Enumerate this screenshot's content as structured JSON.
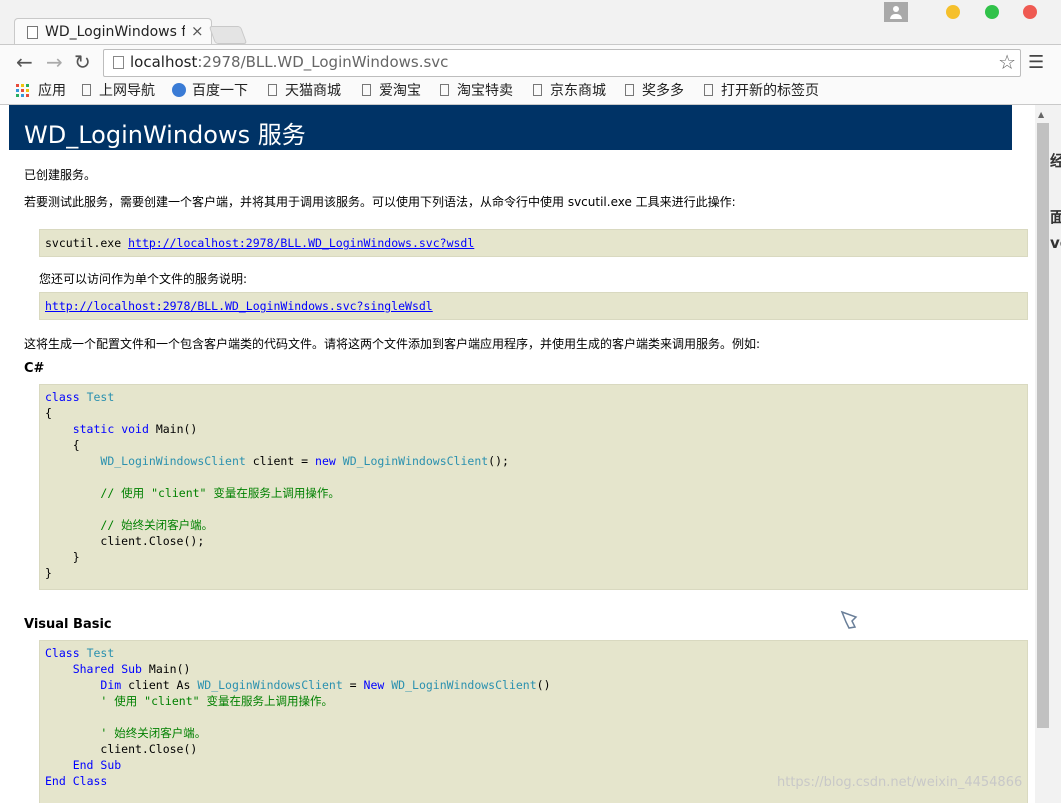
{
  "browser": {
    "tab_title": "WD_LoginWindows f",
    "tab_close": "×",
    "url_host": "localhost",
    "url_rest": ":2978/BLL.WD_LoginWindows.svc",
    "bookmarks": [
      "应用",
      "上网导航",
      "百度一下",
      "天猫商城",
      "爱淘宝",
      "淘宝特卖",
      "京东商城",
      "奖多多",
      "打开新的标签页"
    ]
  },
  "page": {
    "title": "WD_LoginWindows 服务",
    "created": "已创建服务。",
    "intro": "若要测试此服务，需要创建一个客户端，并将其用于调用该服务。可以使用下列语法，从命令行中使用 svcutil.exe 工具来进行此操作:",
    "svcutil_cmd": "svcutil.exe ",
    "wsdl_url": "http://localhost:2978/BLL.WD_LoginWindows.svc?wsdl",
    "single_note": "您还可以访问作为单个文件的服务说明:",
    "single_url": "http://localhost:2978/BLL.WD_LoginWindows.svc?singleWsdl",
    "generate_note": "这将生成一个配置文件和一个包含客户端类的代码文件。请将这两个文件添加到客户端应用程序，并使用生成的客户端类来调用服务。例如:",
    "csharp_heading": "C#",
    "vb_heading": "Visual Basic"
  },
  "code": {
    "cs_class": "class",
    "cs_test": "Test",
    "cs_static": "static",
    "cs_void": "void",
    "cs_main": " Main()",
    "cs_client_type": "WD_LoginWindowsClient",
    "cs_client_var": " client = ",
    "cs_new": "new",
    "cs_ctor_end": "();",
    "cs_comment1": "// 使用 \"client\" 变量在服务上调用操作。",
    "cs_comment2": "// 始终关闭客户端。",
    "cs_close": "client.Close();",
    "vb_class": "Class",
    "vb_shared": "Shared",
    "vb_sub": "Sub",
    "vb_main": " Main()",
    "vb_dim": "Dim",
    "vb_as": " client As ",
    "vb_eq": " = ",
    "vb_new": "New",
    "vb_parens": "()",
    "vb_comment1": "' 使用 \"client\" 变量在服务上调用操作。",
    "vb_comment2": "' 始终关闭客户端。",
    "vb_close": "client.Close()",
    "vb_end": "End"
  },
  "watermark": "https://blog.csdn.net/weixin_4454866",
  "peek_chars": [
    "经",
    "面",
    "ve"
  ]
}
